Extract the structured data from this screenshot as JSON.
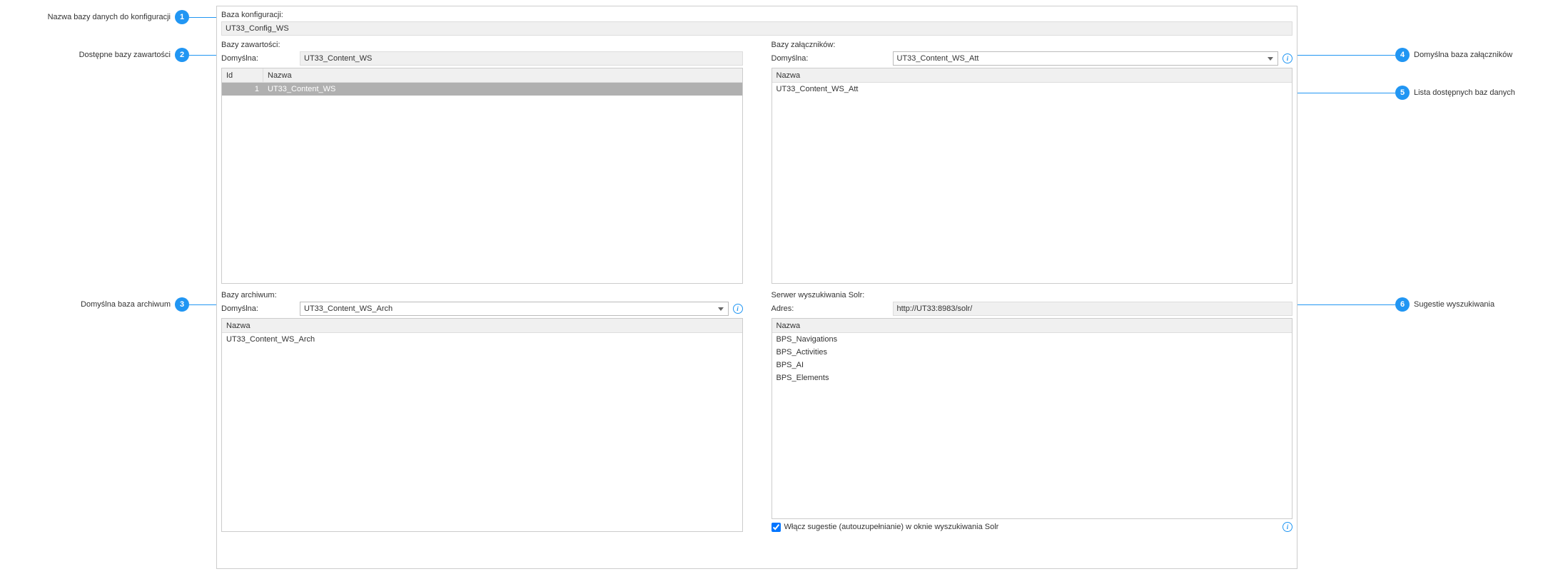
{
  "callouts": {
    "c1": "Nazwa bazy danych do konfiguracji",
    "c2": "Dostępne bazy zawartości",
    "c3": "Domyślna baza archiwum",
    "c4": "Domyślna baza załączników",
    "c5": "Lista dostępnych baz danych",
    "c6": "Sugestie wyszukiwania"
  },
  "config": {
    "label": "Baza konfiguracji:",
    "value": "UT33_Config_WS"
  },
  "content": {
    "title": "Bazy zawartości:",
    "default_label": "Domyślna:",
    "default_value": "UT33_Content_WS",
    "list_header_id": "Id",
    "list_header_name": "Nazwa",
    "rows": [
      {
        "id": "1",
        "name": "UT33_Content_WS"
      }
    ]
  },
  "attachments": {
    "title": "Bazy załączników:",
    "default_label": "Domyślna:",
    "default_value": "UT33_Content_WS_Att",
    "list_header_name": "Nazwa",
    "rows": [
      {
        "name": "UT33_Content_WS_Att"
      }
    ]
  },
  "archive": {
    "title": "Bazy archiwum:",
    "default_label": "Domyślna:",
    "default_value": "UT33_Content_WS_Arch",
    "list_header_name": "Nazwa",
    "rows": [
      {
        "name": "UT33_Content_WS_Arch"
      }
    ]
  },
  "solr": {
    "title": "Serwer wyszukiwania Solr:",
    "address_label": "Adres:",
    "address_value": "http://UT33:8983/solr/",
    "list_header_name": "Nazwa",
    "rows": [
      {
        "name": "BPS_Navigations"
      },
      {
        "name": "BPS_Activities"
      },
      {
        "name": "BPS_AI"
      },
      {
        "name": "BPS_Elements"
      }
    ],
    "checkbox_label": "Włącz sugestie (autouzupełnianie) w oknie wyszukiwania Solr"
  }
}
